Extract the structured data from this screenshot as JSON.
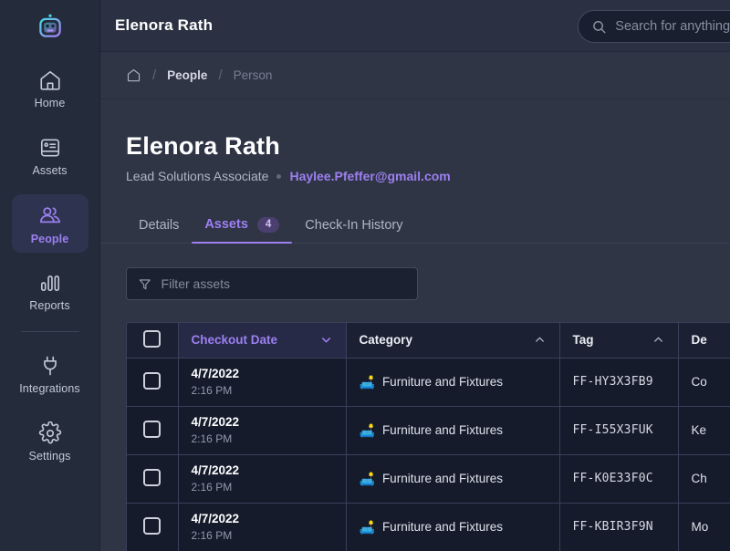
{
  "sidebar": {
    "logo": "robot-logo",
    "items": [
      {
        "label": "Home",
        "icon": "home-icon",
        "active": false
      },
      {
        "label": "Assets",
        "icon": "monitor-icon",
        "active": false
      },
      {
        "label": "People",
        "icon": "people-icon",
        "active": true
      },
      {
        "label": "Reports",
        "icon": "bar-chart-icon",
        "active": false
      }
    ],
    "bottom_items": [
      {
        "label": "Integrations",
        "icon": "plug-icon",
        "active": false
      },
      {
        "label": "Settings",
        "icon": "gear-icon",
        "active": false
      }
    ]
  },
  "topbar": {
    "title": "Elenora Rath",
    "search_placeholder": "Search for anything",
    "search_value": ""
  },
  "breadcrumb": {
    "home_icon": "home-outline-icon",
    "separator": "/",
    "items": [
      {
        "label": "People",
        "muted": false
      },
      {
        "label": "Person",
        "muted": true
      }
    ]
  },
  "profile": {
    "name": "Elenora Rath",
    "role": "Lead Solutions Associate",
    "email": "Haylee.Pfeffer@gmail.com"
  },
  "tabs": [
    {
      "label": "Details",
      "badge": null,
      "active": false
    },
    {
      "label": "Assets",
      "badge": "4",
      "active": true
    },
    {
      "label": "Check-In History",
      "badge": null,
      "active": false
    }
  ],
  "filter": {
    "icon": "funnel-icon",
    "placeholder": "Filter assets",
    "value": ""
  },
  "table": {
    "select_all_checkbox": "unchecked",
    "columns": [
      {
        "label": "Checkout Date",
        "sort": "desc",
        "sorted": true
      },
      {
        "label": "Category",
        "sort": "asc",
        "sorted": false
      },
      {
        "label": "Tag",
        "sort": "asc",
        "sorted": false
      },
      {
        "label": "De",
        "sort": null,
        "sorted": false
      }
    ],
    "rows": [
      {
        "checked": false,
        "date": "4/7/2022",
        "time": "2:16 PM",
        "category_emoji": "🛋️",
        "category": "Furniture and Fixtures",
        "tag": "FF-HY3X3FB9",
        "description": "Co"
      },
      {
        "checked": false,
        "date": "4/7/2022",
        "time": "2:16 PM",
        "category_emoji": "🛋️",
        "category": "Furniture and Fixtures",
        "tag": "FF-I55X3FUK",
        "description": "Ke"
      },
      {
        "checked": false,
        "date": "4/7/2022",
        "time": "2:16 PM",
        "category_emoji": "🛋️",
        "category": "Furniture and Fixtures",
        "tag": "FF-K0E33F0C",
        "description": "Ch"
      },
      {
        "checked": false,
        "date": "4/7/2022",
        "time": "2:16 PM",
        "category_emoji": "🛋️",
        "category": "Furniture and Fixtures",
        "tag": "FF-KBIR3F9N",
        "description": "Mo"
      }
    ]
  },
  "colors": {
    "accent": "#9d7ff0",
    "sidebar_bg": "#242b3a",
    "main_bg": "#2f3545",
    "table_bg": "#151b2b",
    "topbar_bg": "#2b3142"
  }
}
